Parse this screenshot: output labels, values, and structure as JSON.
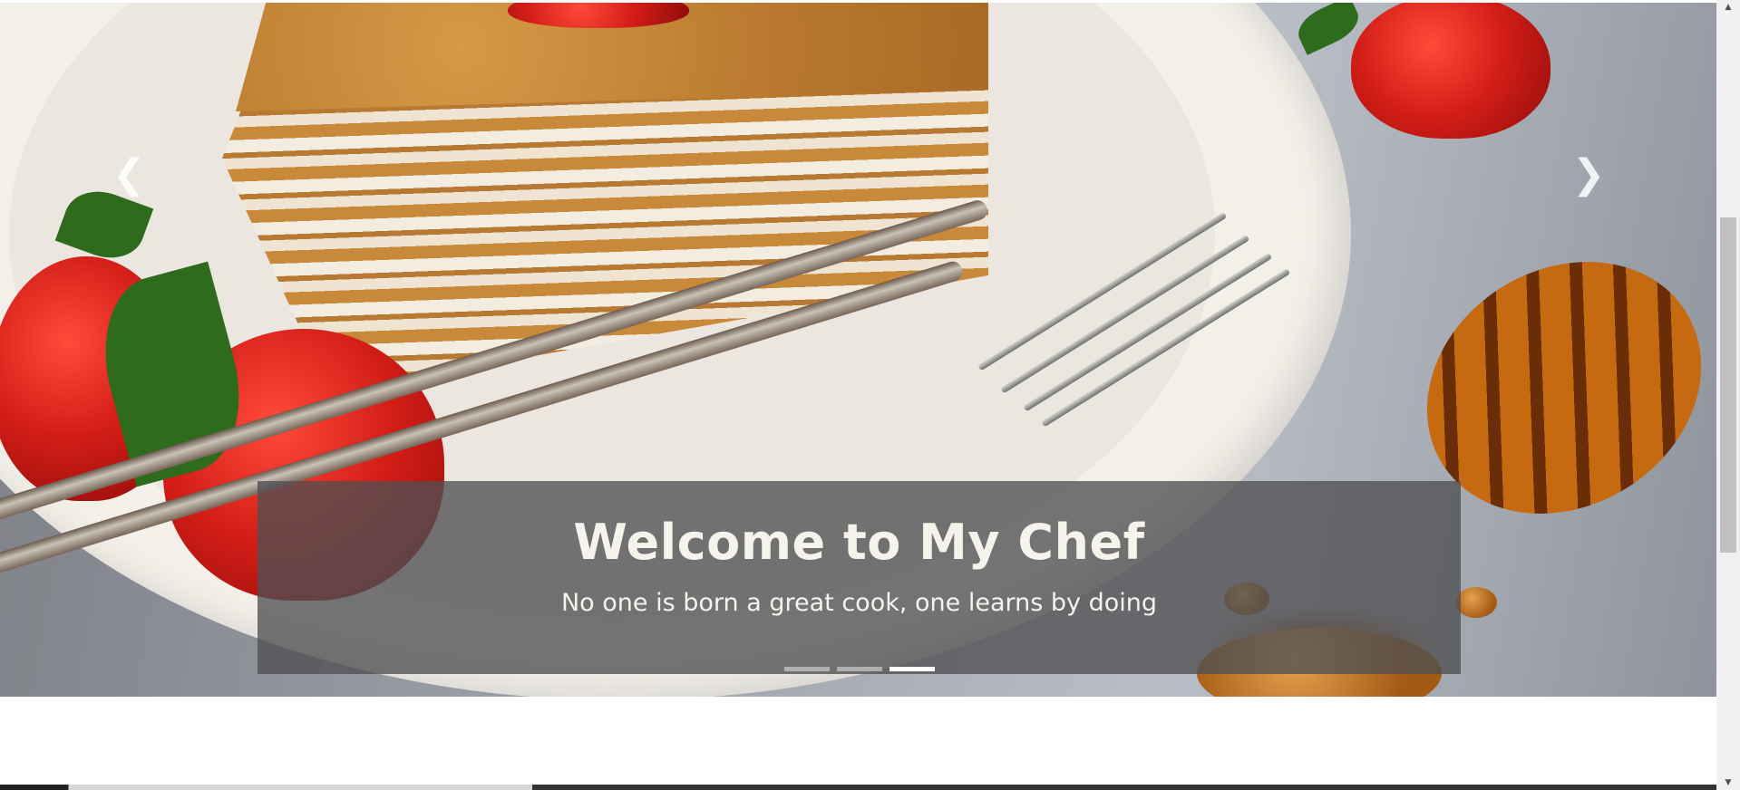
{
  "carousel": {
    "image_subject": "honey cake slice with strawberries, fork and honey dipper",
    "prev_icon": "chevron-left-icon",
    "next_icon": "chevron-right-icon",
    "prev_glyph": "❮",
    "next_glyph": "❯",
    "caption": {
      "title": "Welcome to My Chef",
      "subtitle": "No one is born a great cook, one learns by doing"
    },
    "slide_count": 3,
    "active_slide": 3
  },
  "scrollbar": {
    "up_glyph": "▲",
    "down_glyph": "▼"
  },
  "colors": {
    "caption_bg": "#505052",
    "caption_text": "#f6f2ec",
    "page_bg": "#ffffff"
  }
}
